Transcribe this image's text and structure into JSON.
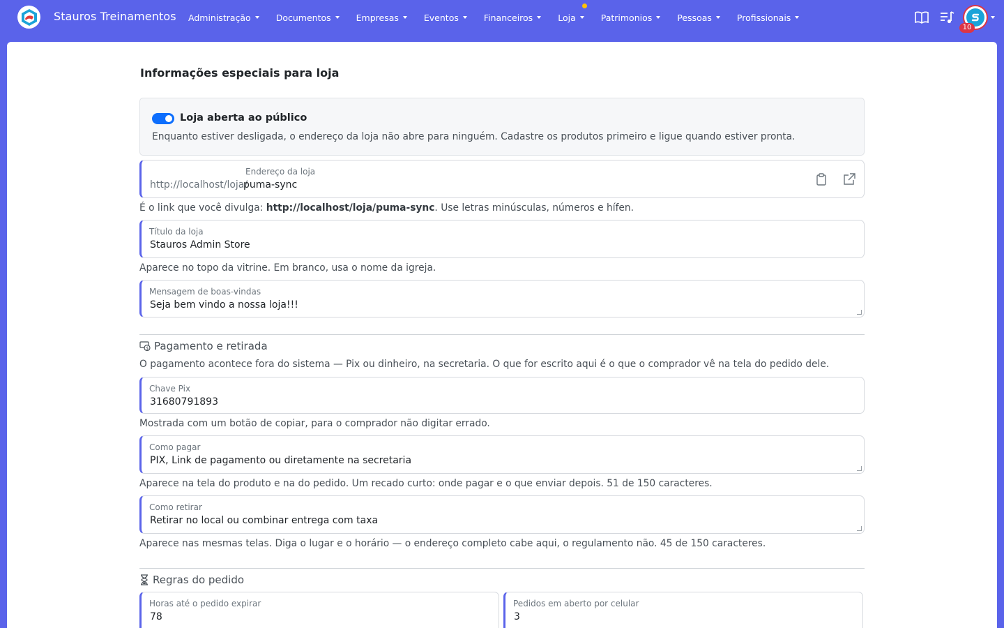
{
  "navbar": {
    "brand": "Stauros Treinamentos",
    "menu": [
      {
        "label": "Administração"
      },
      {
        "label": "Documentos"
      },
      {
        "label": "Empresas"
      },
      {
        "label": "Eventos"
      },
      {
        "label": "Financeiros"
      },
      {
        "label": "Loja"
      },
      {
        "label": "Patrimonios"
      },
      {
        "label": "Pessoas"
      },
      {
        "label": "Profissionais"
      }
    ],
    "notification_count": "10",
    "icons": [
      "book-icon",
      "playlist-music-icon",
      "user-avatar"
    ],
    "colors": {
      "nav_bg": "#5a63ea",
      "badge": "#dc3545",
      "dot": "#ffc107"
    }
  },
  "page": {
    "title": "Informações especiais para loja"
  },
  "store_status": {
    "toggle_label": "Loja aberta ao público",
    "toggle_on": true,
    "description": "Enquanto estiver desligada, o endereço da loja não abre para ninguém. Cadastre os produtos primeiro e ligue quando estiver pronta."
  },
  "address": {
    "label": "Endereço da loja",
    "prefix": "http://localhost/loja/",
    "value": "puma-sync",
    "help_pre": "É o link que você divulga: ",
    "help_link": "http://localhost/loja/puma-sync",
    "help_post": ". Use letras minúsculas, números e hífen."
  },
  "store_title": {
    "label": "Título da loja",
    "value": "Stauros Admin Store",
    "help": "Aparece no topo da vitrine. Em branco, usa o nome da igreja."
  },
  "welcome": {
    "label": "Mensagem de boas-vindas",
    "value": "Seja bem vindo a nossa loja!!!"
  },
  "payment_section": {
    "title": "Pagamento e retirada",
    "description": "O pagamento acontece fora do sistema — Pix ou dinheiro, na secretaria. O que for escrito aqui é o que o comprador vê na tela do pedido dele.",
    "pix": {
      "label": "Chave Pix",
      "value": "31680791893",
      "help": "Mostrada com um botão de copiar, para o comprador não digitar errado."
    },
    "how_to_pay": {
      "label": "Como pagar",
      "value": "PIX, Link de pagamento ou diretamente na secretaria",
      "help": "Aparece na tela do produto e na do pedido. Um recado curto: onde pagar e o que enviar depois. 51 de 150 caracteres."
    },
    "how_to_pickup": {
      "label": "Como retirar",
      "value": "Retirar no local ou combinar entrega com taxa",
      "help": "Aparece nas mesmas telas. Diga o lugar e o horário — o endereço completo cabe aqui, o regulamento não. 45 de 150 caracteres."
    }
  },
  "order_rules": {
    "title": "Regras do pedido",
    "expire_hours": {
      "label": "Horas até o pedido expirar",
      "value": "78"
    },
    "open_orders": {
      "label": "Pedidos em aberto por celular",
      "value": "3"
    }
  }
}
